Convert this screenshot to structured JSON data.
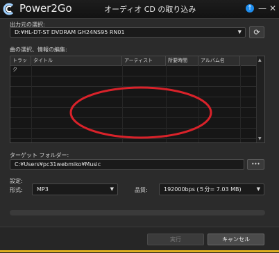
{
  "window": {
    "app_title": "Power2Go",
    "title": "オーディオ CD の取り込み",
    "update_icon": "↑",
    "minimize_icon": "—",
    "close_icon": "✕"
  },
  "output": {
    "label": "出力元の選択:",
    "drive": "D:¥HL-DT-ST DVDRAM GH24NS95 RN01",
    "refresh_icon": "⟳"
  },
  "tracks": {
    "label": "曲の選択、情報の編集:",
    "columns": [
      "トラック",
      "タイトル",
      "アーティスト",
      "所要時間",
      "アルバム名"
    ],
    "rows": []
  },
  "target": {
    "label": "ターゲット フォルダー:",
    "path": "C:¥Users¥pc31webmiko¥Music",
    "browse_label": "•••"
  },
  "settings": {
    "label": "設定:",
    "format_label": "形式:",
    "format_value": "MP3",
    "quality_label": "品質:",
    "quality_value": "192000bps (５分= 7.03 MB)"
  },
  "progress": {
    "value": 0
  },
  "buttons": {
    "run": "実行",
    "cancel": "キャンセル"
  },
  "colors": {
    "annotation_ellipse": "#d9222a",
    "accent": "#e0b020",
    "update_badge": "#1e8ef0"
  }
}
